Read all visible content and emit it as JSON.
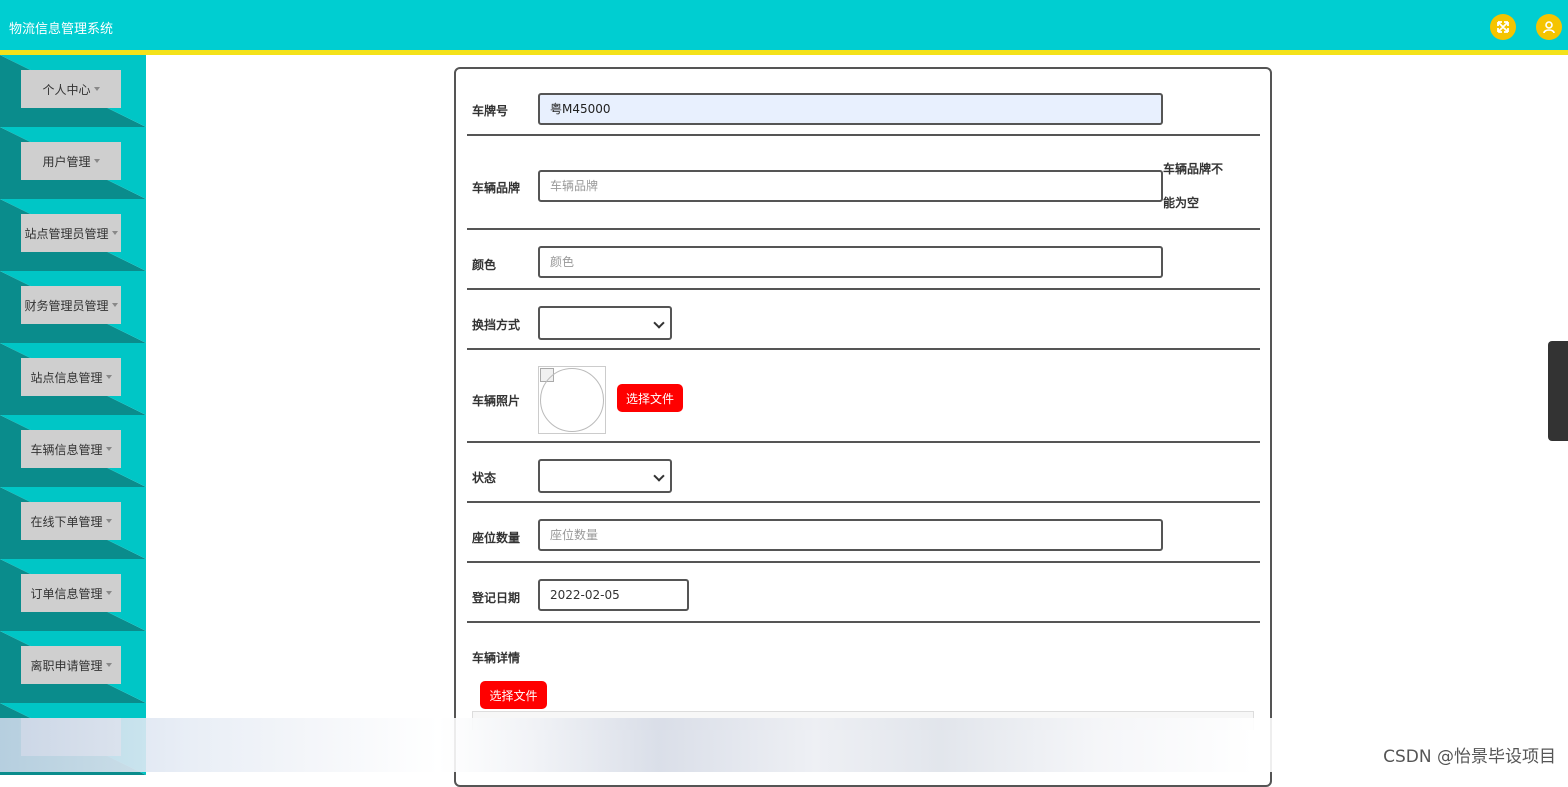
{
  "app": {
    "title": "物流信息管理系统"
  },
  "topbar": {
    "icons": [
      "fullscreen-icon",
      "user-icon"
    ],
    "accent": "#00ced1",
    "stripe": "#f4e21a"
  },
  "sidebar": {
    "items": [
      {
        "label": "个人中心"
      },
      {
        "label": "用户管理"
      },
      {
        "label": "站点管理员管理"
      },
      {
        "label": "财务管理员管理"
      },
      {
        "label": "站点信息管理"
      },
      {
        "label": "车辆信息管理"
      },
      {
        "label": "在线下单管理"
      },
      {
        "label": "订单信息管理"
      },
      {
        "label": "离职申请管理"
      }
    ]
  },
  "form": {
    "plate": {
      "label": "车牌号",
      "value": "粤M45000"
    },
    "brand": {
      "label": "车辆品牌",
      "placeholder": "车辆品牌",
      "error": "车辆品牌不能为空"
    },
    "color": {
      "label": "颜色",
      "placeholder": "颜色"
    },
    "gear": {
      "label": "换挡方式",
      "value": ""
    },
    "photo": {
      "label": "车辆照片",
      "button": "选择文件"
    },
    "status": {
      "label": "状态",
      "value": ""
    },
    "seats": {
      "label": "座位数量",
      "placeholder": "座位数量"
    },
    "date": {
      "label": "登记日期",
      "value": "2022-02-05"
    },
    "detail": {
      "label": "车辆详情",
      "button": "选择文件"
    }
  },
  "watermark": "CSDN @怡景毕设项目",
  "colors": {
    "danger": "#ff0000",
    "sidebar_dark": "#0a8c8c",
    "sidebar_light": "#00c6c6"
  }
}
